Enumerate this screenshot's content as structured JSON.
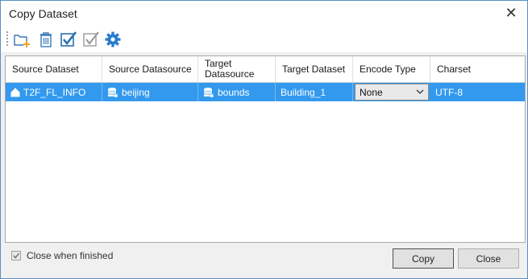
{
  "window": {
    "title": "Copy Dataset"
  },
  "toolbar": {
    "icons": [
      "add-folder-icon",
      "delete-icon",
      "select-all-icon",
      "invert-selection-icon",
      "settings-icon"
    ]
  },
  "grid": {
    "columns": [
      "Source Dataset",
      "Source Datasource",
      "Target Datasource",
      "Target Dataset",
      "Encode Type",
      "Charset"
    ],
    "rows": [
      {
        "source_dataset": "T2F_FL_INFO",
        "source_datasource": "beijing",
        "target_datasource": "bounds",
        "target_dataset": "Building_1",
        "encode_type": "None",
        "charset": "UTF-8"
      }
    ]
  },
  "footer": {
    "close_when_finished": "Close when finished",
    "close_when_finished_checked": true,
    "copy_label": "Copy",
    "close_label": "Close"
  },
  "colors": {
    "selection": "#3399ee",
    "accent": "#2a6fb0"
  }
}
